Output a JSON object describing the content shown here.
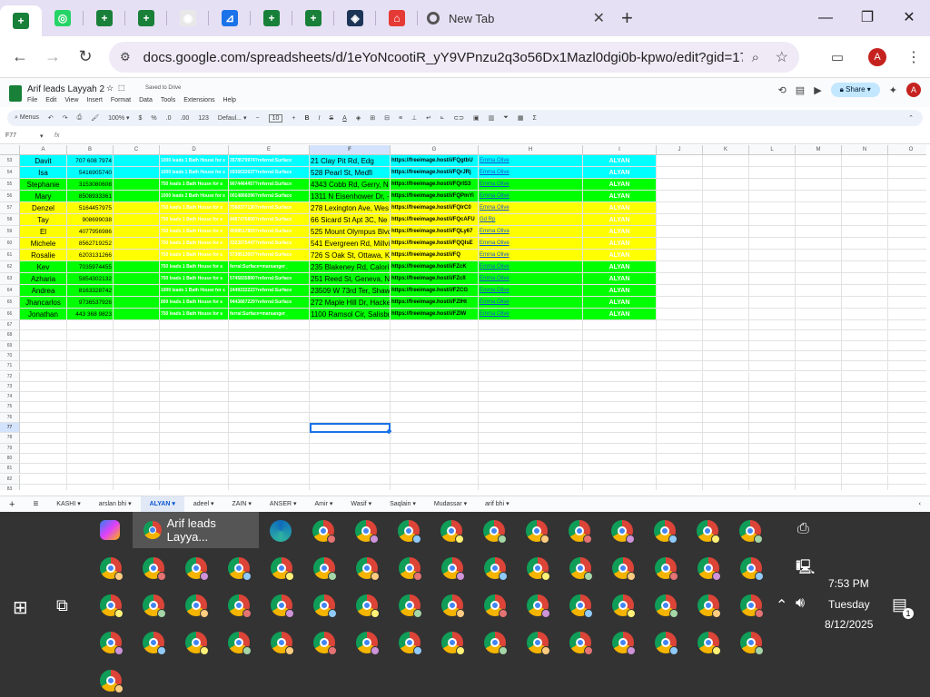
{
  "browser": {
    "new_tab_label": "New Tab",
    "url": "docs.google.com/spreadsheets/d/1eYoNcootiR_yY9VPnzu2q3o56Dx1Mazl0dgi0b-kpwo/edit?gid=17269...",
    "profile_initial": "A",
    "tab_icon_colors": [
      "#188038",
      "#25d366",
      "#188038",
      "#188038",
      "#e8e8e8",
      "#1a73e8",
      "#188038",
      "#188038",
      "#1d3557",
      "#e53935"
    ]
  },
  "doc": {
    "title": "Arif leads Layyah 2",
    "saved_status": "Saved to Drive",
    "menus": [
      "File",
      "Edit",
      "View",
      "Insert",
      "Format",
      "Data",
      "Tools",
      "Extensions",
      "Help"
    ],
    "share_label": "Share",
    "user_initial": "A"
  },
  "toolbar": {
    "menus_label": "Menus",
    "zoom": "100%",
    "currency": "$",
    "percent": "%",
    "dec_dec": ".0",
    "dec_inc": ".00",
    "number_format": "123",
    "font": "Defaul...",
    "font_size": "10"
  },
  "formula_bar": {
    "cell_ref": "F77",
    "fx": "fx"
  },
  "grid": {
    "columns": [
      "A",
      "B",
      "C",
      "D",
      "E",
      "F",
      "G",
      "H",
      "I",
      "J",
      "K",
      "L",
      "M",
      "N",
      "O"
    ],
    "selected_column": "F",
    "selected_row": "77",
    "rows": [
      {
        "num": "53",
        "color": "#00ffff",
        "A": "Davit",
        "B": "707 608 7974",
        "C": "",
        "D": "1000 leads 1 Bath House for s",
        "E": "3578579974?referral:Surface",
        "F": "21 Clay Pit Rd, Edg",
        "G": "https://freeimage.host/i/FQgtbU",
        "H": "Emma Olive",
        "I": "ALYAN"
      },
      {
        "num": "54",
        "color": "#00ffff",
        "A": "Isa",
        "B": "5416905740",
        "C": "",
        "D": "1000 leads 1 Bath House for s",
        "E": "5936632637?referral:Surface",
        "F": "528 Pearl St, Medfi",
        "G": "https://freeimage.host/i/FQrJRj",
        "H": "Emma Olive",
        "I": "ALYAN"
      },
      {
        "num": "55",
        "color": "#00ff00",
        "A": "Stephanie",
        "B": "3153080608",
        "C": "",
        "D": "750 leads 1 Bath House for s",
        "E": "9074464457?referral:Surface",
        "F": "4343 Cobb Rd, Gerry, N",
        "G": "https://freeimage.host/i/FQrIS3",
        "H": "Emma Olive",
        "I": "ALYAN"
      },
      {
        "num": "56",
        "color": "#00ff00",
        "A": "Mary",
        "B": "8508933361",
        "C": "",
        "D": "1000 leads 2 Bath House for s",
        "E": "0014866096?referral:Surface",
        "F": "1311 N Eisenhower Dr, -",
        "G": "https://freeimage.host/i/FQPmYi",
        "H": "Emma Olive",
        "I": "ALYAN"
      },
      {
        "num": "57",
        "color": "#ffff00",
        "A": "Denzel",
        "B": "5164457975",
        "C": "",
        "D": "750 leads 1 Bath House for s",
        "E": "7588377130?referral:Surface",
        "F": "278 Lexington Ave, Wes",
        "G": "https://freeimage.host/i/FQIrC0",
        "H": "Emma Olive",
        "I": "ALYAN"
      },
      {
        "num": "58",
        "color": "#ffff00",
        "A": "Tay",
        "B": "908699038",
        "C": "",
        "D": "750 leads 1 Bath House for s",
        "E": "8487476800?referral:Surface",
        "F": "66 Sicard St Apt 3C, Ne",
        "G": "https://freeimage.host/i/FQcAFU",
        "H": "Gd Rp",
        "I": "ALYAN"
      },
      {
        "num": "59",
        "color": "#ffff00",
        "A": "El",
        "B": "4077956986",
        "C": "",
        "D": "750 leads 1 Bath House for s",
        "E": "4098517893?referral:Surface",
        "F": "525 Mount Olympus Blvd",
        "G": "https://freeimage.host/i/FQLy67",
        "H": "Emma Oliva",
        "I": "ALYAN"
      },
      {
        "num": "60",
        "color": "#ffff00",
        "A": "Michele",
        "B": "8562719252",
        "C": "",
        "D": "750 leads 1 Bath House for s",
        "E": "3323575447?referral:Surface",
        "F": "541 Evergreen Rd, Millvi",
        "G": "https://freeimage.host/i/FQQlsE",
        "H": "Emma Olive",
        "I": "ALYAN"
      },
      {
        "num": "61",
        "color": "#ffff00",
        "A": "Rosalie",
        "B": "6203131266",
        "C": "",
        "D": "750 leads 1 Bath House for s",
        "E": "5738513007?referral:Surface",
        "F": "726 S Oak St, Ottawa, K",
        "G": "https://freeimage.host/i/FQ",
        "H": "Emma Olive",
        "I": "ALYAN"
      },
      {
        "num": "62",
        "color": "#00ff00",
        "A": "Kev",
        "B": "7035974455",
        "C": "",
        "D": "750 leads 1 Bath House for s",
        "E": "ferral:Surface=marsanger_",
        "F": "235 Blakeney Rd, Calori",
        "G": "https://freeimage.host/i/FZcK",
        "H": "Emma Olive",
        "I": "ALYAN"
      },
      {
        "num": "63",
        "color": "#00ff00",
        "A": "Azharia",
        "B": "5854302132",
        "C": "",
        "D": "750 leads 1 Bath House for s",
        "E": "5745835890?referral:Surface",
        "F": "251 Reed St, Geneva, N",
        "G": "https://freeimage.host/i/FZcll",
        "H": "Emma Olive",
        "I": "ALYAN"
      },
      {
        "num": "64",
        "color": "#00ff00",
        "A": "Andrea",
        "B": "8163328742",
        "C": "",
        "D": "1000 leads 1 Bath House for s",
        "E": "2449232223?referral:Surface",
        "F": "23509 W 73rd Ter, Shaw",
        "G": "https://freeimage.host/i/FZCG",
        "H": "Emma Olive",
        "I": "ALYAN"
      },
      {
        "num": "65",
        "color": "#00ff00",
        "A": "Jhancarlos",
        "B": "9736537926",
        "C": "",
        "D": "800 leads 1 Bath House for s",
        "E": "9443867229?referral:Surface",
        "F": "272 Maple Hill Dr, Hacke",
        "G": "https://freeimage.host/i/FZIHt",
        "H": "Emma Olive",
        "I": "ALYAN"
      },
      {
        "num": "66",
        "color": "#00ff00",
        "A": "Jonathan",
        "B": "443 368 9823",
        "C": "",
        "D": "750 leads 1 Bath House for s",
        "E": "ferral:Surface=marsanger_",
        "F": "1100 Ramsol Cir, Salisbury",
        "G": "https://freeimage.host/i/FZIW",
        "H": "Emma Olive",
        "I": "ALYAN"
      }
    ],
    "empty_rows": [
      "67",
      "68",
      "69",
      "70",
      "71",
      "72",
      "73",
      "74",
      "75",
      "76",
      "77",
      "78",
      "79",
      "80",
      "81",
      "82",
      "83"
    ]
  },
  "sheet_tabs": {
    "add": "+",
    "list": "≡",
    "tabs": [
      "KASHI",
      "arslan bhi",
      "ALYAN",
      "adeel",
      "ZAIN",
      "ANSER",
      "Amir",
      "Wasif",
      "Saqlain",
      "Mudassar",
      "arif bhi"
    ],
    "active": "ALYAN"
  },
  "taskbar": {
    "active_window": "Arif leads Layya...",
    "time": "7:53 PM",
    "day": "Tuesday",
    "date": "8/12/2025",
    "notification_count": "1"
  }
}
